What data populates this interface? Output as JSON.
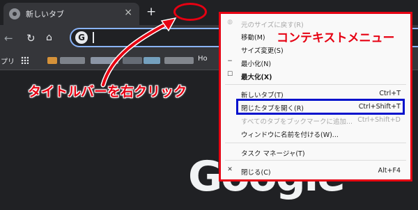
{
  "tab": {
    "title": "新しいタブ",
    "close": "×",
    "favicon": "chrome-icon"
  },
  "newtab": {
    "label": "+"
  },
  "toolbar": {
    "back": "←",
    "forward": "↻",
    "home": "⌂",
    "omnibox_icon": "G"
  },
  "bookmarks": {
    "apps_label": "プリ",
    "last_label": "Ho"
  },
  "page": {
    "logo": "Google"
  },
  "annotation": {
    "label": "タイトルバーを右クリック",
    "menu_title": "コンテキストメニュー",
    "color": "#e60012",
    "highlight_color": "#0011cc"
  },
  "menu": {
    "items": [
      {
        "icon": "◍",
        "label": "元のサイズに戻す(R)",
        "shortcut": "",
        "disabled": true,
        "bold": false
      },
      {
        "icon": "",
        "label": "移動(M)",
        "shortcut": "",
        "disabled": false,
        "bold": false
      },
      {
        "icon": "",
        "label": "サイズ変更(S)",
        "shortcut": "",
        "disabled": false,
        "bold": false
      },
      {
        "icon": "−",
        "label": "最小化(N)",
        "shortcut": "",
        "disabled": false,
        "bold": false
      },
      {
        "icon": "☐",
        "label": "最大化(X)",
        "shortcut": "",
        "disabled": false,
        "bold": true
      },
      {
        "icon": "",
        "label": "新しいタブ(T)",
        "shortcut": "Ctrl+T",
        "disabled": false,
        "bold": false
      },
      {
        "icon": "",
        "label": "閉じたタブを開く(R)",
        "shortcut": "Ctrl+Shift+T",
        "disabled": false,
        "bold": false
      },
      {
        "icon": "",
        "label": "すべてのタブをブックマークに追加...",
        "shortcut": "Ctrl+Shift+D",
        "disabled": true,
        "bold": false
      },
      {
        "icon": "",
        "label": "ウィンドウに名前を付ける(W)...",
        "shortcut": "",
        "disabled": false,
        "bold": false
      },
      {
        "icon": "",
        "label": "タスク マネージャ(T)",
        "shortcut": "",
        "disabled": false,
        "bold": false
      },
      {
        "icon": "✕",
        "label": "閉じる(C)",
        "shortcut": "Alt+F4",
        "disabled": false,
        "bold": false
      }
    ]
  }
}
